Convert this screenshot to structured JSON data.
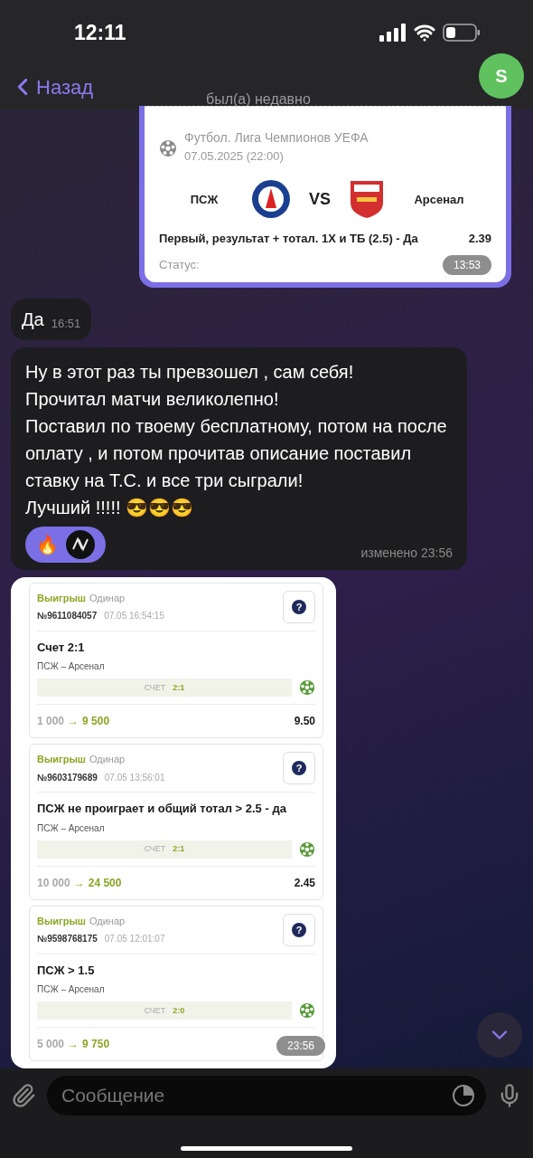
{
  "status_bar": {
    "time": "12:11"
  },
  "header": {
    "back": "Назад",
    "status": "был(а) недавно",
    "avatar": "S"
  },
  "bet_card": {
    "league": "Футбол. Лига Чемпионов УЕФА",
    "date": "07.05.2025 (22:00)",
    "home": "ПСЖ",
    "vs": "VS",
    "away": "Арсенал",
    "market": "Первый, результат + тотал. 1X и ТБ (2.5) - Да",
    "odds": "2.39",
    "status_label": "Статус:",
    "time": "13:53"
  },
  "messages": [
    {
      "text": "Да",
      "time": "16:51"
    },
    {
      "text": "Ну в этот раз ты превзошел , сам себя!\nПрочитал матчи великолепно!\nПоставил по твоему бесплатному, потом на после оплату , и потом прочитав описание поставил ставку на Т.С. и все три сыграли!\nЛучший !!!!! 😎😎😎",
      "reaction": "🔥",
      "time": "изменено 23:56"
    }
  ],
  "tickets": [
    {
      "result": "Выигрыш",
      "type": "Одинар",
      "number": "№9611084057",
      "datetime": "07.05 16:54:15",
      "help": "?",
      "bet": "Счет 2:1",
      "match": "ПСЖ – Арсенал",
      "score_label": "СЧЕТ",
      "score": "2:1",
      "stake": "1 000",
      "arrow": "→",
      "payout": "9 500",
      "odds": "9.50"
    },
    {
      "result": "Выигрыш",
      "type": "Одинар",
      "number": "№9603179689",
      "datetime": "07.05 13:56:01",
      "help": "?",
      "bet": "ПСЖ не проиграет и общий тотал > 2.5 - да",
      "match": "ПСЖ – Арсенал",
      "score_label": "СЧЕТ",
      "score": "2:1",
      "stake": "10 000",
      "arrow": "→",
      "payout": "24 500",
      "odds": "2.45"
    },
    {
      "result": "Выигрыш",
      "type": "Одинар",
      "number": "№9598768175",
      "datetime": "07.05 12:01:07",
      "help": "?",
      "bet": "ПСЖ > 1.5",
      "match": "ПСЖ – Арсенал",
      "score_label": "СЧЕТ",
      "score": "2:0",
      "stake": "5 000",
      "arrow": "→",
      "payout": "9 750"
    }
  ],
  "tickets_time": "23:56",
  "composer": {
    "placeholder": "Сообщение"
  }
}
